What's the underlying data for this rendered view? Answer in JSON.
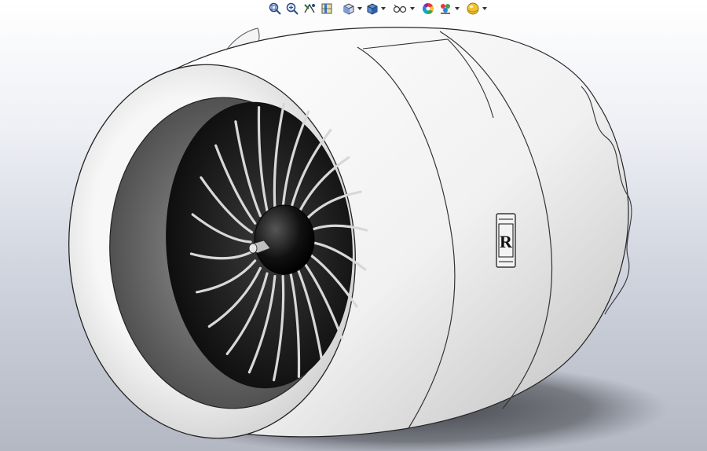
{
  "toolbar": {
    "items": [
      {
        "name": "zoom-to-fit",
        "icon": "magnifier-fit-icon"
      },
      {
        "name": "zoom-to-area",
        "icon": "magnifier-area-icon"
      },
      {
        "name": "previous-view",
        "icon": "previous-view-icon"
      },
      {
        "name": "section-view",
        "icon": "section-view-icon"
      },
      {
        "name": "view-orientation",
        "icon": "cube-orientation-icon",
        "has_dropdown": true
      },
      {
        "name": "display-style",
        "icon": "shaded-cube-icon",
        "has_dropdown": true
      },
      {
        "name": "hide-show-items",
        "icon": "eye-glasses-icon",
        "has_dropdown": true
      },
      {
        "name": "edit-appearance",
        "icon": "color-wheel-icon"
      },
      {
        "name": "apply-scene",
        "icon": "scene-icon",
        "has_dropdown": true
      },
      {
        "name": "view-settings",
        "icon": "realview-sphere-icon",
        "has_dropdown": true
      }
    ]
  },
  "model": {
    "subject": "turbofan-engine-nacelle",
    "blade_count": 22,
    "logo_glyph": "R",
    "colors": {
      "nacelle": "#f2f2f2",
      "nacelle_shade": "#c9c9c9",
      "inlet_dark": "#2a2a2a",
      "blade": "#d8d8d8",
      "spinner": "#111111",
      "shadow": "#4a4c52"
    }
  }
}
